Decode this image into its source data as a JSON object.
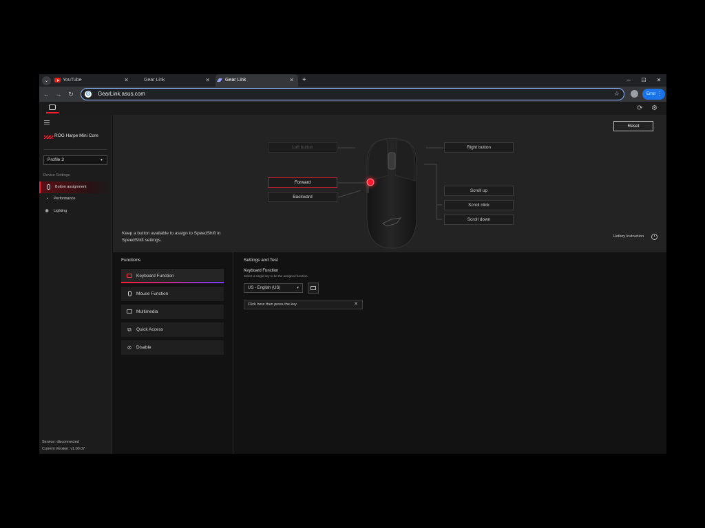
{
  "browser": {
    "tabs": [
      {
        "label": "YouTube",
        "icon": "youtube-icon"
      },
      {
        "label": "Gear Link",
        "icon": "gear-link-icon"
      },
      {
        "label": "Gear Link",
        "icon": "gear-link-icon",
        "active": true
      }
    ],
    "new_tab": "+",
    "url": "GearLink.asus.com",
    "error_label": "Error",
    "window_controls": {
      "minimize": "─",
      "maximize": "☐",
      "close": "✕"
    }
  },
  "sidebar": {
    "device_name": "ROG Harpe Mini Core",
    "profile": "Profile 3",
    "section_title": "Device Settings",
    "items": [
      {
        "label": "Button assignment",
        "icon": "mouse-icon",
        "active": true
      },
      {
        "label": "Performance",
        "icon": "gauge-icon"
      },
      {
        "label": "Lighting",
        "icon": "lighting-icon"
      }
    ],
    "service_status": "Service: disconnected",
    "version": "Current Version: v1.00.07"
  },
  "mapping": {
    "reset_label": "Reset",
    "left_button": "Left button",
    "forward": "Forward",
    "backward": "Backward",
    "right_button": "Right button",
    "scroll_up": "Scroll up",
    "scroll_click": "Scroll click",
    "scroll_down": "Scroll down",
    "tip": "Keep a button available to assign to SpeedShift in SpeedShift settings.",
    "hotkey_instruction": "Hotkey Instruction",
    "accent_color": "#ff1a2e"
  },
  "functions": {
    "title": "Functions",
    "items": [
      {
        "label": "Keyboard Function",
        "icon": "keyboard-icon",
        "active": true
      },
      {
        "label": "Mouse Function",
        "icon": "mouse-icon"
      },
      {
        "label": "Multimedia",
        "icon": "multimedia-icon"
      },
      {
        "label": "Quick Access",
        "icon": "quick-access-icon"
      },
      {
        "label": "Disable",
        "icon": "disable-icon"
      }
    ]
  },
  "settings": {
    "title": "Settings and Test",
    "subtitle": "Keyboard Function",
    "description": "Select a single key to be the assigned function.",
    "language": "US - English (US)",
    "key_placeholder": "Click here then press the key."
  }
}
